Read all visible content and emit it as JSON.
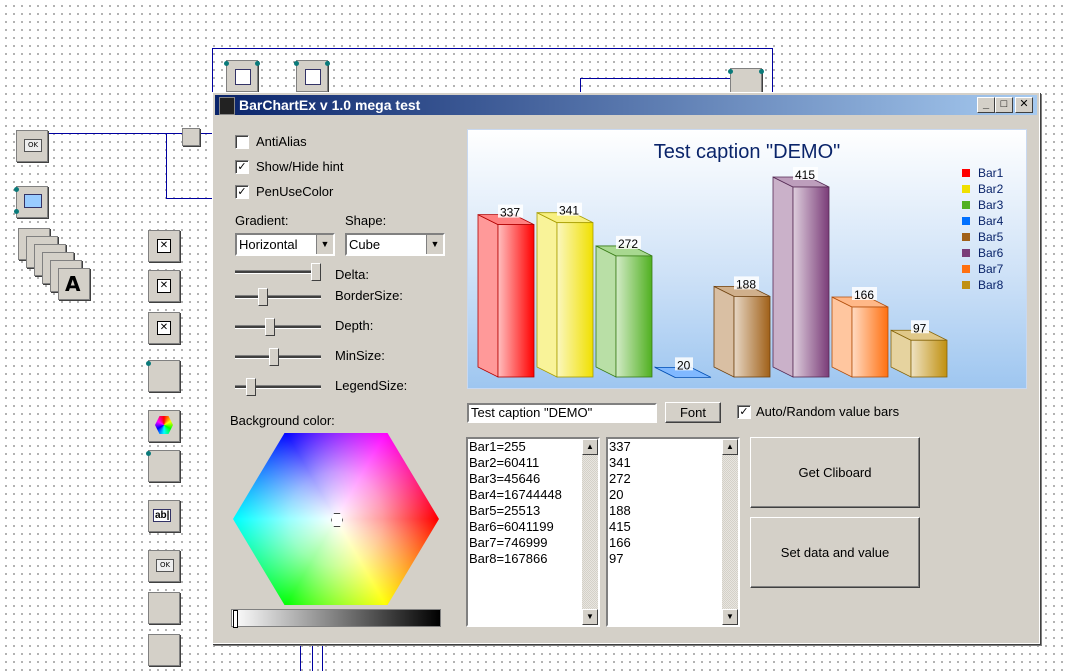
{
  "window": {
    "title": "BarChartEx v 1.0 mega test",
    "minimize": "_",
    "maximize": "□",
    "close": "✕"
  },
  "options": {
    "antialias": {
      "label": "AntiAlias",
      "checked": false
    },
    "show_hide_hint": {
      "label": "Show/Hide hint",
      "checked": true
    },
    "pen_use_color": {
      "label": "PenUseColor",
      "checked": true
    },
    "check_mark": "✓"
  },
  "gradient": {
    "label": "Gradient:",
    "value": "Horizontal"
  },
  "shape": {
    "label": "Shape:",
    "value": "Cube"
  },
  "sliders": [
    {
      "label": "Delta:",
      "value": 1.0
    },
    {
      "label": "BorderSize:",
      "value": 0.3
    },
    {
      "label": "Depth:",
      "value": 0.4
    },
    {
      "label": "MinSize:",
      "value": 0.45
    },
    {
      "label": "LegendSize:",
      "value": 0.15
    }
  ],
  "background_color": {
    "label": "Background color:"
  },
  "caption_input": {
    "value": "Test caption \"DEMO\""
  },
  "font_button": "Font",
  "auto_random": {
    "label": "Auto/Random value bars",
    "checked": true
  },
  "names_memo": [
    "Bar1=255",
    "Bar2=60411",
    "Bar3=45646",
    "Bar4=16744448",
    "Bar5=25513",
    "Bar6=6041199",
    "Bar7=746999",
    "Bar8=167866"
  ],
  "values_memo": [
    "337",
    "341",
    "272",
    "20",
    "188",
    "415",
    "166",
    "97"
  ],
  "get_clipboard_button": "Get Cliboard",
  "set_data_button": "Set data and value",
  "chart_data": {
    "type": "bar",
    "title": "Test caption \"DEMO\"",
    "categories": [
      "Bar1",
      "Bar2",
      "Bar3",
      "Bar4",
      "Bar5",
      "Bar6",
      "Bar7",
      "Bar8"
    ],
    "values": [
      337,
      341,
      272,
      20,
      188,
      415,
      166,
      97
    ],
    "colors": [
      "#ff0000",
      "#f0e000",
      "#50b020",
      "#0070ff",
      "#a06018",
      "#7a3c78",
      "#ff7010",
      "#c09010"
    ],
    "legend_position": "right",
    "shape": "cube",
    "ylim": [
      0,
      415
    ]
  }
}
